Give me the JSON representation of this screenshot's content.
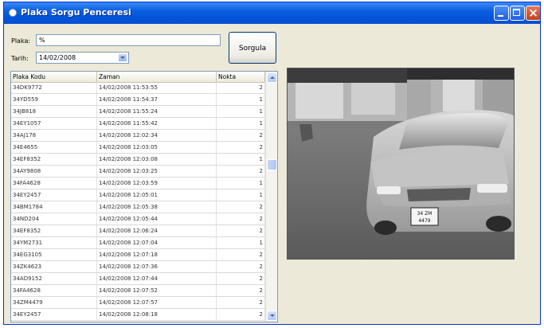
{
  "window": {
    "title": "Plaka Sorgu Penceresi"
  },
  "form": {
    "plaka_label": "Plaka:",
    "plaka_value": "%",
    "tarih_label": "Tarih:",
    "tarih_value": "14/02/2008",
    "query_button_label": "Sorgula"
  },
  "table": {
    "columns": [
      "Plaka Kodu",
      "Zaman",
      "Nokta"
    ],
    "selected_row_index": 21,
    "rows": [
      [
        "34DK9772",
        "14/02/2008 11:53:55",
        "2"
      ],
      [
        "34YD559",
        "14/02/2008 11:54:37",
        "1"
      ],
      [
        "34JB818",
        "14/02/2008 11:55:24",
        "1"
      ],
      [
        "34EY1057",
        "14/02/2008 11:55:42",
        "1"
      ],
      [
        "34AJ178",
        "14/02/2008 12:02:34",
        "2"
      ],
      [
        "34E4655",
        "14/02/2008 12:03:05",
        "2"
      ],
      [
        "34EF8352",
        "14/02/2008 12:03:08",
        "1"
      ],
      [
        "34AY9808",
        "14/02/2008 12:03:25",
        "2"
      ],
      [
        "34FA4628",
        "14/02/2008 12:03:59",
        "1"
      ],
      [
        "34EY2457",
        "14/02/2008 12:05:01",
        "1"
      ],
      [
        "34BM1784",
        "14/02/2008 12:05:38",
        "2"
      ],
      [
        "34ND204",
        "14/02/2008 12:05:44",
        "2"
      ],
      [
        "34EF8352",
        "14/02/2008 12:06:24",
        "2"
      ],
      [
        "34YM2731",
        "14/02/2008 12:07:04",
        "1"
      ],
      [
        "34EG3105",
        "14/02/2008 12:07:18",
        "2"
      ],
      [
        "34ZK4623",
        "14/02/2008 12:07:36",
        "2"
      ],
      [
        "34AD9152",
        "14/02/2008 12:07:44",
        "2"
      ],
      [
        "34FA4628",
        "14/02/2008 12:07:52",
        "2"
      ],
      [
        "34ZM4479",
        "14/02/2008 12:07:57",
        "2"
      ],
      [
        "34EY2457",
        "14/02/2008 12:08:18",
        "2"
      ]
    ]
  },
  "photo": {
    "plate_line1": "34 ZM",
    "plate_line2": "4479"
  }
}
